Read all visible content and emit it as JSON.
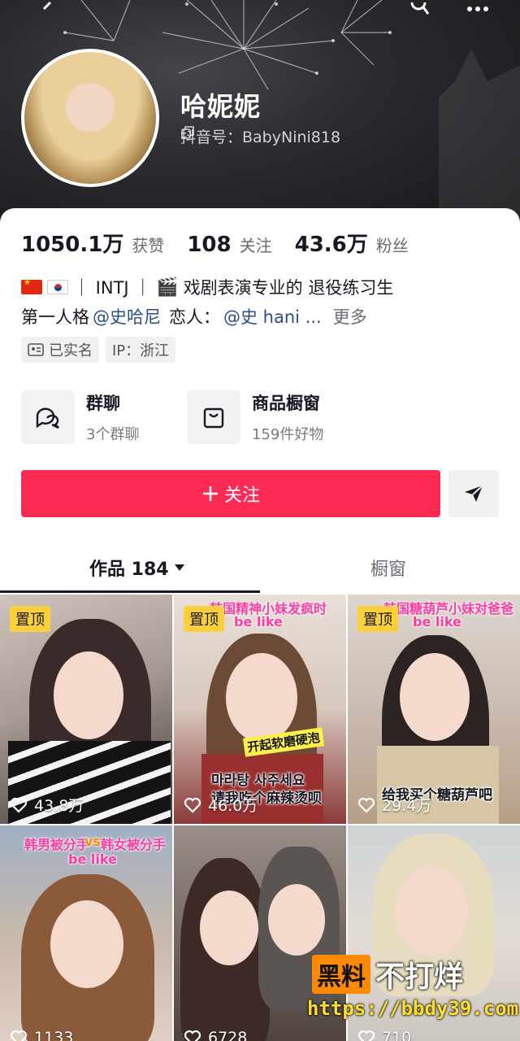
{
  "header": {
    "nickname": "哈妮妮",
    "douyin_id": "抖音号：BabyNini818"
  },
  "stats": [
    {
      "value": "1050.1万",
      "label": "获赞"
    },
    {
      "value": "108",
      "label": "关注"
    },
    {
      "value": "43.6万",
      "label": "粉丝"
    }
  ],
  "bio": {
    "line1_text": "｜ INTJ ｜",
    "line1_rest": "戏剧表演专业的 退役练习生",
    "line2_prefix": "第一人格",
    "mention1": "@史哈尼",
    "line2_mid": "恋人：",
    "mention2": "@史 hani ...",
    "more": "更多"
  },
  "tags": {
    "verified": "已实名",
    "ip": "IP：浙江"
  },
  "features": {
    "group": {
      "title": "群聊",
      "sub": "3个群聊"
    },
    "shop": {
      "title": "商品橱窗",
      "sub": "159件好物"
    }
  },
  "actions": {
    "follow": "关注"
  },
  "tabs": {
    "works": "作品 184",
    "showcase": "橱窗"
  },
  "videos": [
    {
      "pinned": "置顶",
      "likes": "43.8万"
    },
    {
      "pinned": "置顶",
      "likes": "46.0万",
      "caption": "韩国精神小妹发疯时",
      "caption2": "be like",
      "sticker": "开起软磨硬泡",
      "line_ko": "마라탕 사주세요",
      "line_zh": "请我吃个麻辣烫呗"
    },
    {
      "pinned": "置顶",
      "likes": "29.4万",
      "caption": "韩国糖葫芦小妹对爸爸",
      "caption2": "be like",
      "line_zh": "给我买个糖葫芦吧"
    },
    {
      "likes": "1133",
      "caption_left": "韩男被分手",
      "caption_vs": "vs",
      "caption_right": "韩女被分手",
      "caption2": "be like"
    },
    {
      "likes": "6728"
    },
    {
      "likes": "710"
    }
  ],
  "watermark": {
    "box": "黑料",
    "text": "不打烊",
    "url": "https://bbdy39.com"
  },
  "colors": {
    "accent": "#fe2c55",
    "pin": "#fbd03a",
    "mention": "#2b4e8f"
  }
}
